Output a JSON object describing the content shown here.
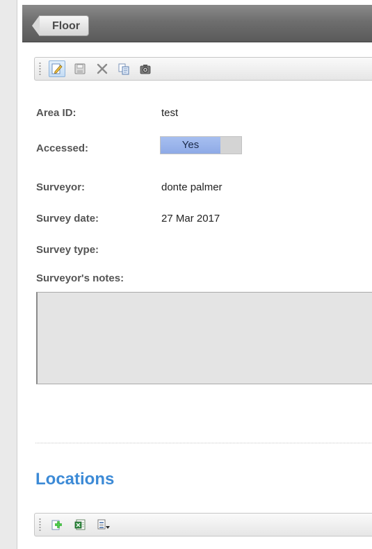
{
  "header": {
    "back_label": "Floor"
  },
  "area_toolbar": {
    "buttons": [
      {
        "icon": "edit-icon",
        "active": true
      },
      {
        "icon": "save-icon"
      },
      {
        "icon": "close-icon"
      },
      {
        "icon": "copy-icon"
      },
      {
        "icon": "camera-icon"
      }
    ]
  },
  "form": {
    "area_id": {
      "label": "Area ID:",
      "value": "test"
    },
    "accessed": {
      "label": "Accessed:",
      "toggle_text": "Yes"
    },
    "surveyor": {
      "label": "Surveyor:",
      "value": "donte palmer"
    },
    "survey_date": {
      "label": "Survey date:",
      "value": "27 Mar 2017"
    },
    "survey_type": {
      "label": "Survey type:",
      "value": ""
    },
    "notes": {
      "label": "Surveyor's notes:",
      "value": ""
    }
  },
  "locations": {
    "title": "Locations",
    "toolbar": {
      "buttons": [
        {
          "icon": "add-icon"
        },
        {
          "icon": "excel-export-icon"
        },
        {
          "icon": "document-dropdown-icon"
        }
      ]
    }
  },
  "colors": {
    "accent": "#3c8ad6",
    "toggle_on": "#9bb5ec"
  }
}
